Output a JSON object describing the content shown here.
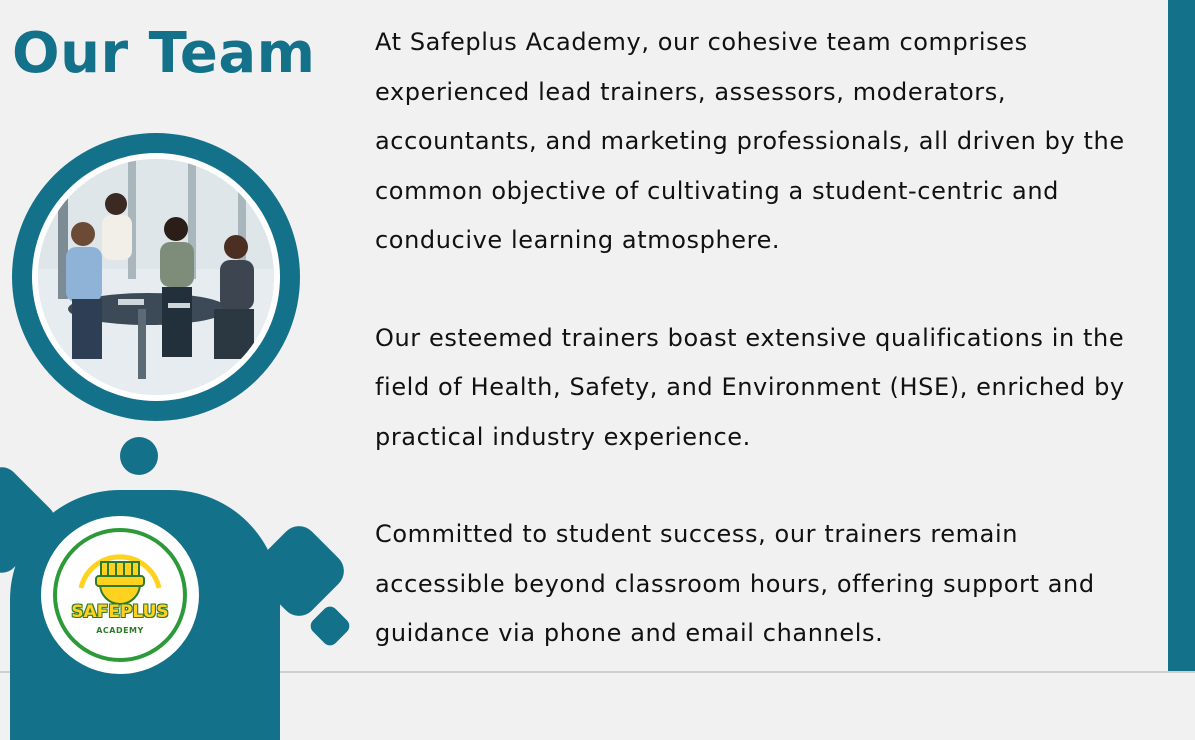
{
  "slide": {
    "title": "Our Team",
    "paragraphs": [
      "At Safeplus Academy, our cohesive team comprises experienced lead trainers, assessors, moderators, accountants, and marketing professionals, all driven by the common objective of cultivating a student-centric and conducive learning atmosphere.",
      "Our esteemed trainers boast extensive qualifications in the field of Health, Safety, and Environment (HSE), enriched by practical industry experience.",
      "Committed to student success, our trainers remain accessible beyond classroom hours, offering support and guidance via phone and email channels."
    ],
    "logo": {
      "name": "SAFEPLUS",
      "sub": "ACADEMY"
    }
  },
  "colors": {
    "accent": "#13718a",
    "background": "#f1f1f1",
    "logo_yellow": "#ffd21f",
    "logo_green": "#2d9a3a"
  }
}
